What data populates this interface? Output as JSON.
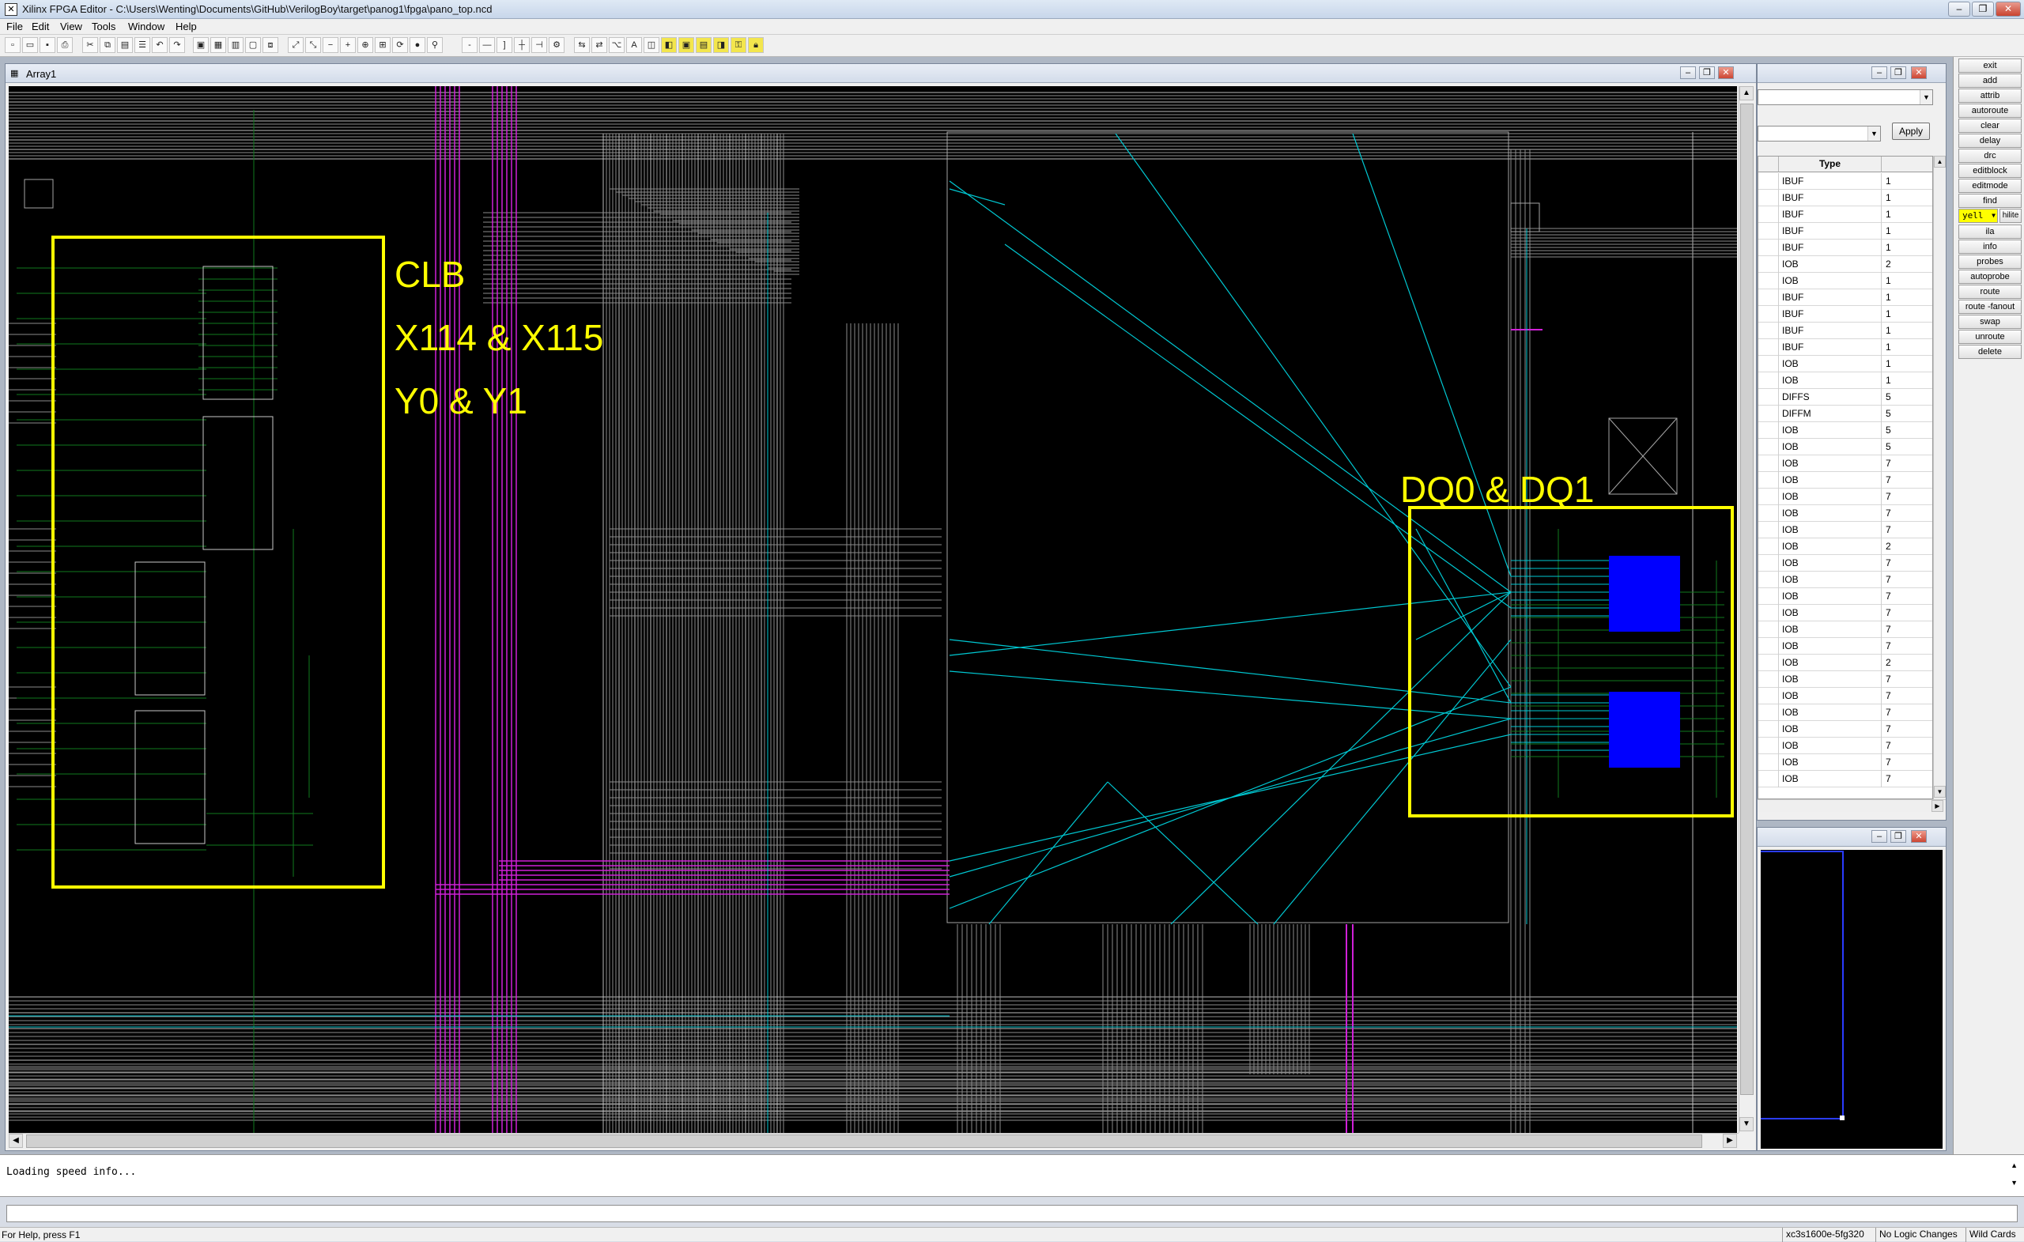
{
  "window": {
    "title": "Xilinx FPGA Editor - C:\\Users\\Wenting\\Documents\\GitHub\\VerilogBoy\\target\\panog1\\fpga\\pano_top.ncd"
  },
  "menu": [
    "File",
    "Edit",
    "View",
    "Tools",
    "Window",
    "Help"
  ],
  "array_window": {
    "title": "Array1"
  },
  "annotations": {
    "clb_line1": "CLB",
    "clb_line2": "X114 & X115",
    "clb_line3": "Y0 & Y1",
    "dq_label": "DQ0 & DQ1"
  },
  "list_window": {
    "apply_label": "Apply",
    "column_type": "Type",
    "rows": [
      {
        "type": "IBUF",
        "val": "1"
      },
      {
        "type": "IBUF",
        "val": "1"
      },
      {
        "type": "IBUF",
        "val": "1"
      },
      {
        "type": "IBUF",
        "val": "1"
      },
      {
        "type": "IBUF",
        "val": "1"
      },
      {
        "type": "IOB",
        "val": "2"
      },
      {
        "type": "IOB",
        "val": "1"
      },
      {
        "type": "IBUF",
        "val": "1"
      },
      {
        "type": "IBUF",
        "val": "1"
      },
      {
        "type": "IBUF",
        "val": "1"
      },
      {
        "type": "IBUF",
        "val": "1"
      },
      {
        "type": "IOB",
        "val": "1"
      },
      {
        "type": "IOB",
        "val": "1"
      },
      {
        "type": "DIFFS",
        "val": "5"
      },
      {
        "type": "DIFFM",
        "val": "5"
      },
      {
        "type": "IOB",
        "val": "5"
      },
      {
        "type": "IOB",
        "val": "5"
      },
      {
        "type": "IOB",
        "val": "7"
      },
      {
        "type": "IOB",
        "val": "7"
      },
      {
        "type": "IOB",
        "val": "7"
      },
      {
        "type": "IOB",
        "val": "7"
      },
      {
        "type": "IOB",
        "val": "7"
      },
      {
        "type": "IOB",
        "val": "2"
      },
      {
        "type": "IOB",
        "val": "7"
      },
      {
        "type": "IOB",
        "val": "7"
      },
      {
        "type": "IOB",
        "val": "7"
      },
      {
        "type": "IOB",
        "val": "7"
      },
      {
        "type": "IOB",
        "val": "7"
      },
      {
        "type": "IOB",
        "val": "7"
      },
      {
        "type": "IOB",
        "val": "2"
      },
      {
        "type": "IOB",
        "val": "7"
      },
      {
        "type": "IOB",
        "val": "7"
      },
      {
        "type": "IOB",
        "val": "7"
      },
      {
        "type": "IOB",
        "val": "7"
      },
      {
        "type": "IOB",
        "val": "7"
      },
      {
        "type": "IOB",
        "val": "7"
      },
      {
        "type": "IOB",
        "val": "7"
      }
    ]
  },
  "commands": [
    "exit",
    "add",
    "attrib",
    "autoroute",
    "clear",
    "delay",
    "drc",
    "editblock",
    "editmode",
    "find",
    "ila",
    "info",
    "probes",
    "autoprobe",
    "route",
    "route -fanout",
    "swap",
    "unroute",
    "delete"
  ],
  "hilite": {
    "value": "yell",
    "label": "hilite"
  },
  "console": {
    "text": "Loading speed info..."
  },
  "status": {
    "help": "For Help, press F1",
    "device": "xc3s1600e-5fg320",
    "logic": "No Logic Changes",
    "wildcards": "Wild Cards"
  },
  "colors": {
    "annotation": "#ffff00",
    "route_cyan": "#00c8d2",
    "route_magenta": "#d020d8",
    "route_grey": "#8c8c8c",
    "route_green": "#0f7a1e",
    "selected_comp": "#0000ff"
  }
}
